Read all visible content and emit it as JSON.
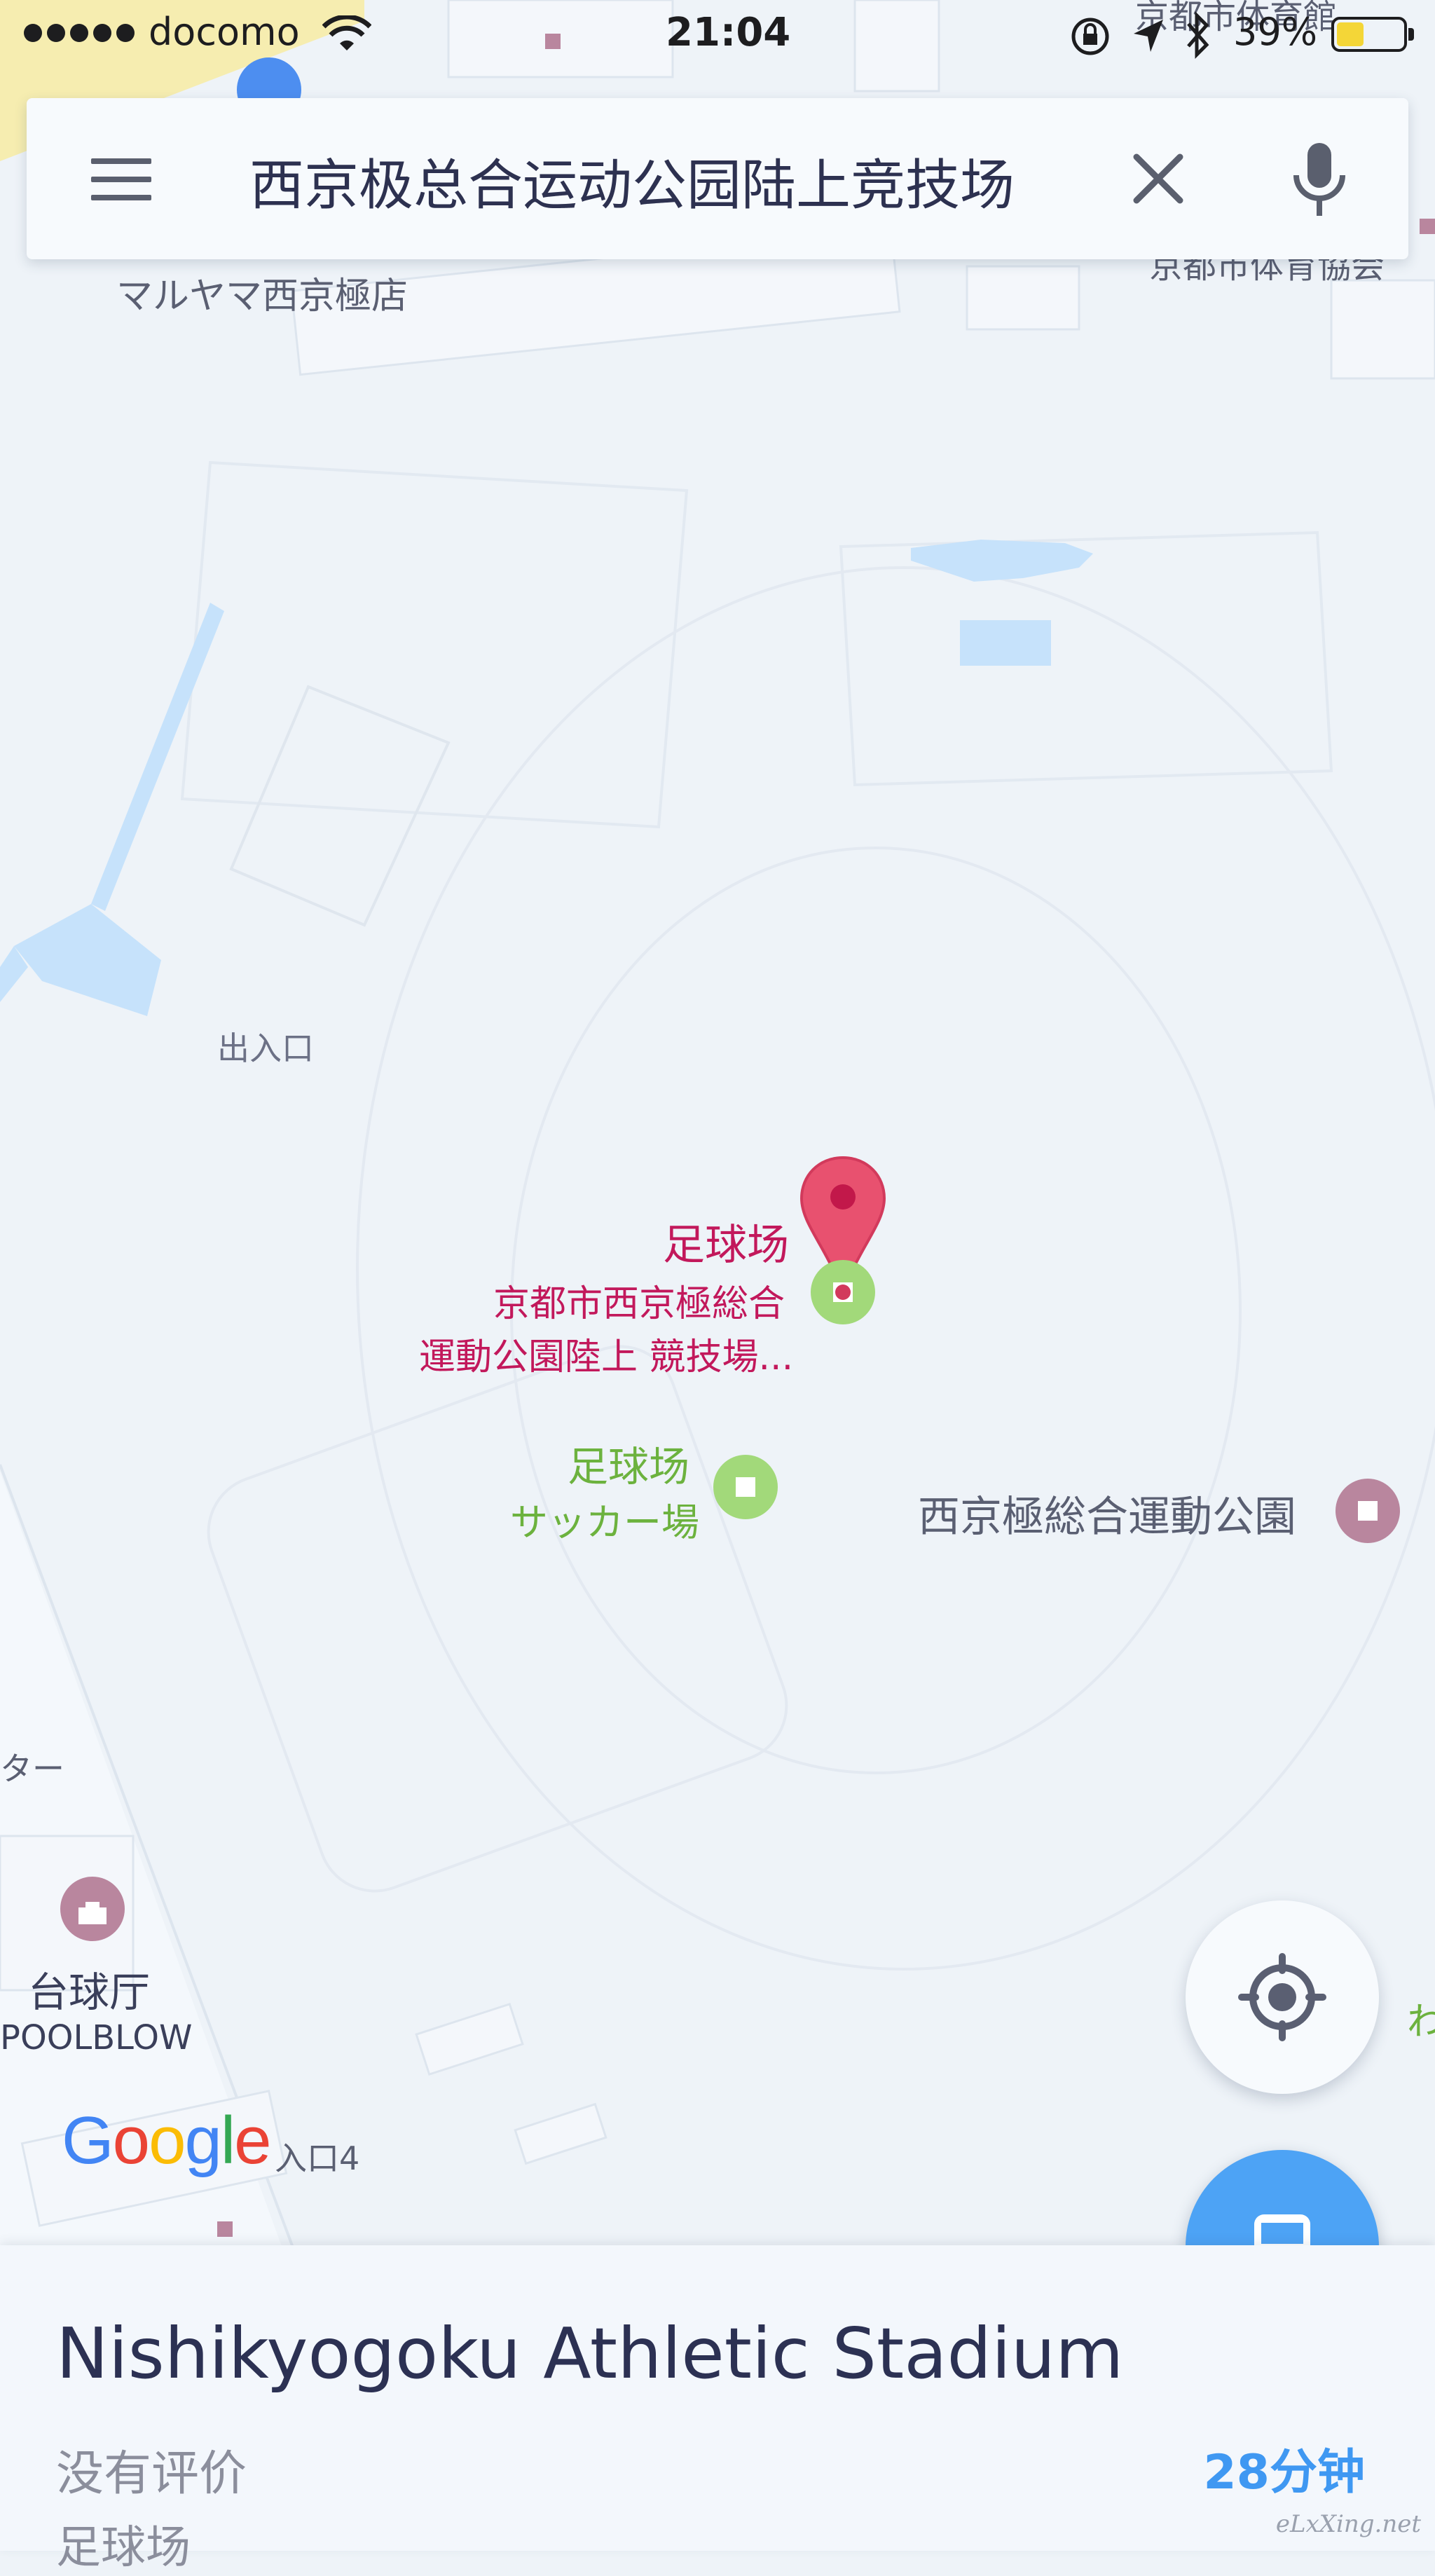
{
  "status_bar": {
    "carrier": "docomo",
    "time": "21:04",
    "battery_percent": "39%",
    "battery_level": 0.39,
    "signal_dots": 5
  },
  "search": {
    "query": "西京极总合运动公园陆上竞技场"
  },
  "map": {
    "labels": {
      "maruyama": "マルヤマ西京極店",
      "kyoto_gym_top": "京都市体育館",
      "kyoto_sports_assoc": "京都市体育協会",
      "entrance": "出入口",
      "pin_category": "足球场",
      "pin_name_line1": "京都市西京極総合",
      "pin_name_line2": "運動公園陸上 競技場...",
      "soccer_category": "足球场",
      "soccer_name": "サッカー場",
      "park_name": "西京極総合運動公園",
      "tower_fragment": "ター",
      "billiards": "台球厅",
      "poolblow": "POOLBLOW",
      "entrance4": "入口4",
      "right_edge_fragment": "わ"
    },
    "google_logo": "Google",
    "colors": {
      "pin": "#e8516f",
      "soccer_poi": "#a2d97a",
      "park_poi": "#b9869e",
      "water": "#c6e2fb",
      "label_red": "#c2185b",
      "label_green": "#6cb23e"
    }
  },
  "bottom_sheet": {
    "title": "Nishikyogoku Athletic Stadium",
    "rating": "没有评价",
    "eta": "28分钟",
    "category": "足球场"
  },
  "watermark": "eLxXing.net",
  "icons": {
    "menu": "hamburger-icon",
    "clear": "close-icon",
    "mic": "microphone-icon",
    "locate": "my-location-icon",
    "transit": "train-icon"
  }
}
